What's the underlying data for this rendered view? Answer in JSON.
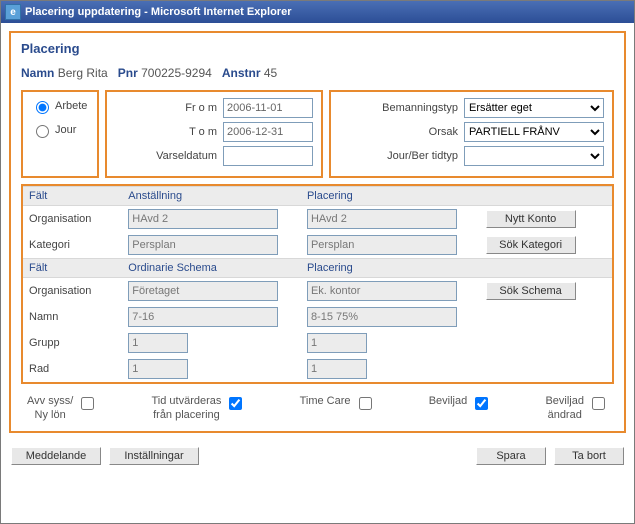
{
  "window": {
    "title": "Placering uppdatering - Microsoft Internet Explorer"
  },
  "page": {
    "heading": "Placering",
    "name_label": "Namn",
    "name_value": "Berg Rita",
    "pnr_label": "Pnr",
    "pnr_value": "700225-9294",
    "anstnr_label": "Anstnr",
    "anstnr_value": "45"
  },
  "type_radio": {
    "arbete": "Arbete",
    "jour": "Jour"
  },
  "dates": {
    "from_label": "Fr o m",
    "from_value": "2006-11-01",
    "to_label": "T o m",
    "to_value": "2006-12-31",
    "varsel_label": "Varseldatum",
    "varsel_value": ""
  },
  "staffing": {
    "bemanningstyp_label": "Bemanningstyp",
    "bemanningstyp_value": "Ersätter eget",
    "orsak_label": "Orsak",
    "orsak_value": "PARTIELL FRÅNV",
    "jourber_label": "Jour/Ber tidtyp",
    "jourber_value": ""
  },
  "grid": {
    "hdr_falt": "Fält",
    "hdr_anst": "Anställning",
    "hdr_plac": "Placering",
    "hdr_ord": "Ordinarie Schema",
    "row_org": "Organisation",
    "row_kat": "Kategori",
    "row_namn": "Namn",
    "row_grupp": "Grupp",
    "row_rad": "Rad",
    "anst_org": "HAvd 2",
    "anst_kat": "Persplan",
    "plac_org": "HAvd 2",
    "plac_kat": "Persplan",
    "ord_org": "Företaget",
    "ord_namn": "7-16",
    "ord_grupp": "1",
    "ord_rad": "1",
    "plac2_org": "Ek. kontor",
    "plac2_namn": "8-15 75%",
    "plac2_grupp": "1",
    "plac2_rad": "1",
    "btn_nytt_konto": "Nytt Konto",
    "btn_sok_kategori": "Sök Kategori",
    "btn_sok_schema": "Sök Schema"
  },
  "checks": {
    "avv": "Avv syss/\nNy lön",
    "tid": "Tid utvärderas\nfrån placering",
    "timecare": "Time Care",
    "beviljad": "Beviljad",
    "beviljad_andrad": "Beviljad\nändrad"
  },
  "footer": {
    "meddelande": "Meddelande",
    "installningar": "Inställningar",
    "spara": "Spara",
    "tabort": "Ta bort"
  }
}
